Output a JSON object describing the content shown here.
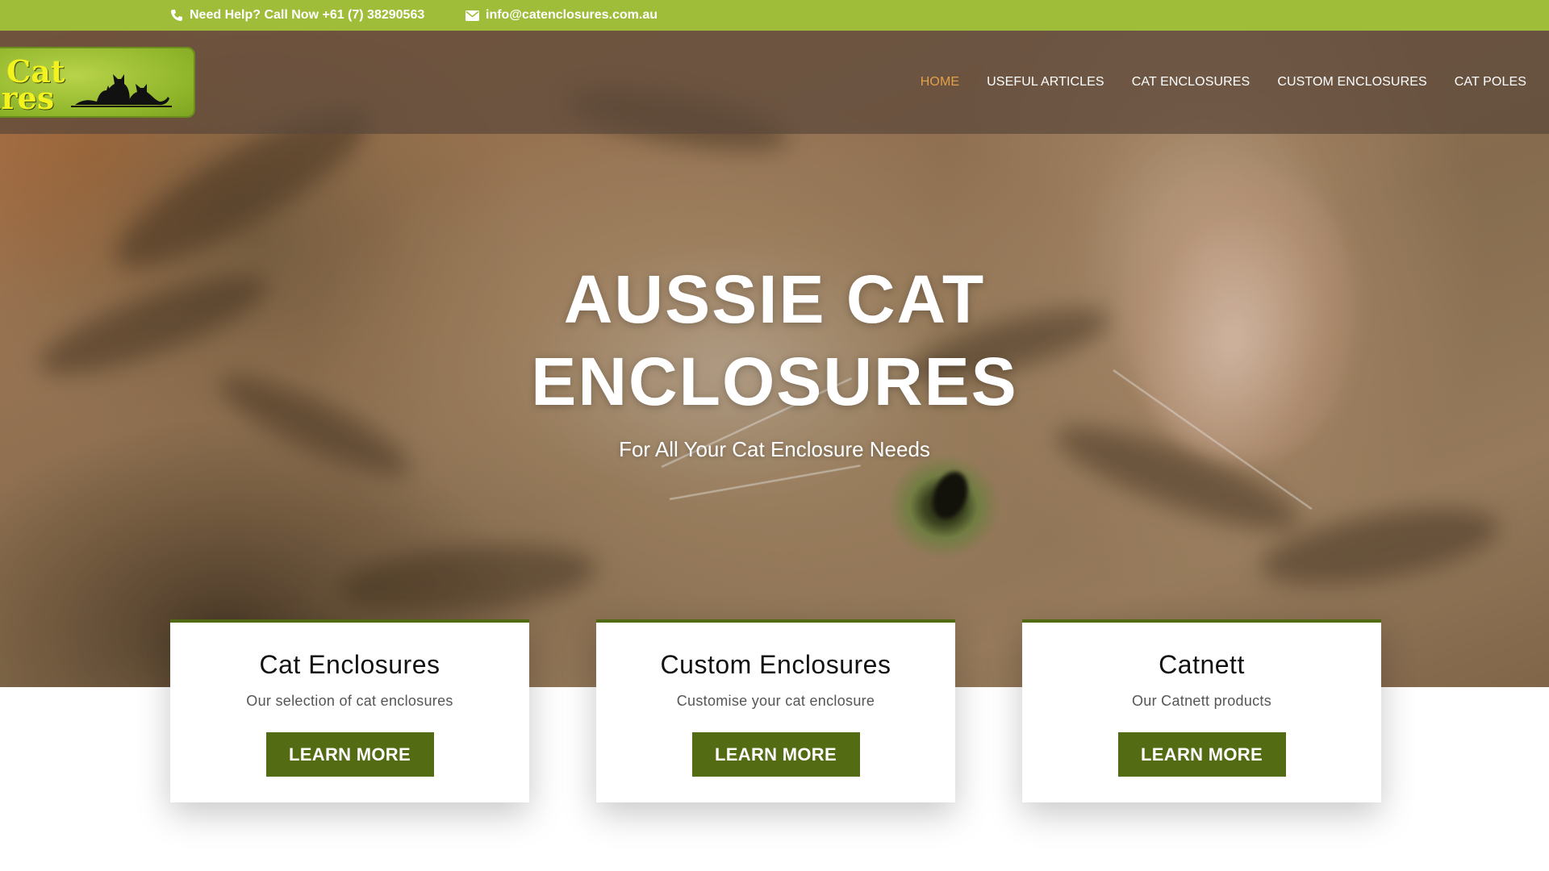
{
  "topbar": {
    "phone_text": "Need Help? Call Now +61 (7) 38290563",
    "email_text": "info@catenclosures.com.au",
    "phone_icon": "phone-icon",
    "email_icon": "envelope-icon",
    "background_color": "#a0bd3a"
  },
  "logo": {
    "line1": "Cat",
    "line2": "ures",
    "icon": "cat-silhouettes-icon"
  },
  "nav": {
    "items": [
      {
        "label": "HOME",
        "active": true
      },
      {
        "label": "USEFUL ARTICLES",
        "active": false
      },
      {
        "label": "CAT ENCLOSURES",
        "active": false
      },
      {
        "label": "CUSTOM ENCLOSURES",
        "active": false
      },
      {
        "label": "CAT POLES",
        "active": false
      }
    ],
    "active_color": "#e3a04b"
  },
  "hero": {
    "title_line1": "AUSSIE CAT",
    "title_line2": "ENCLOSURES",
    "subtitle": "For All Your Cat Enclosure Needs"
  },
  "cards": [
    {
      "title": "Cat Enclosures",
      "description": "Our selection of cat enclosures",
      "button": "LEARN MORE"
    },
    {
      "title": "Custom Enclosures",
      "description": "Customise your cat enclosure",
      "button": "LEARN MORE"
    },
    {
      "title": "Catnett",
      "description": "Our Catnett products",
      "button": "LEARN MORE"
    }
  ],
  "colors": {
    "button": "#536b12",
    "card_border": "#4f6a13"
  }
}
